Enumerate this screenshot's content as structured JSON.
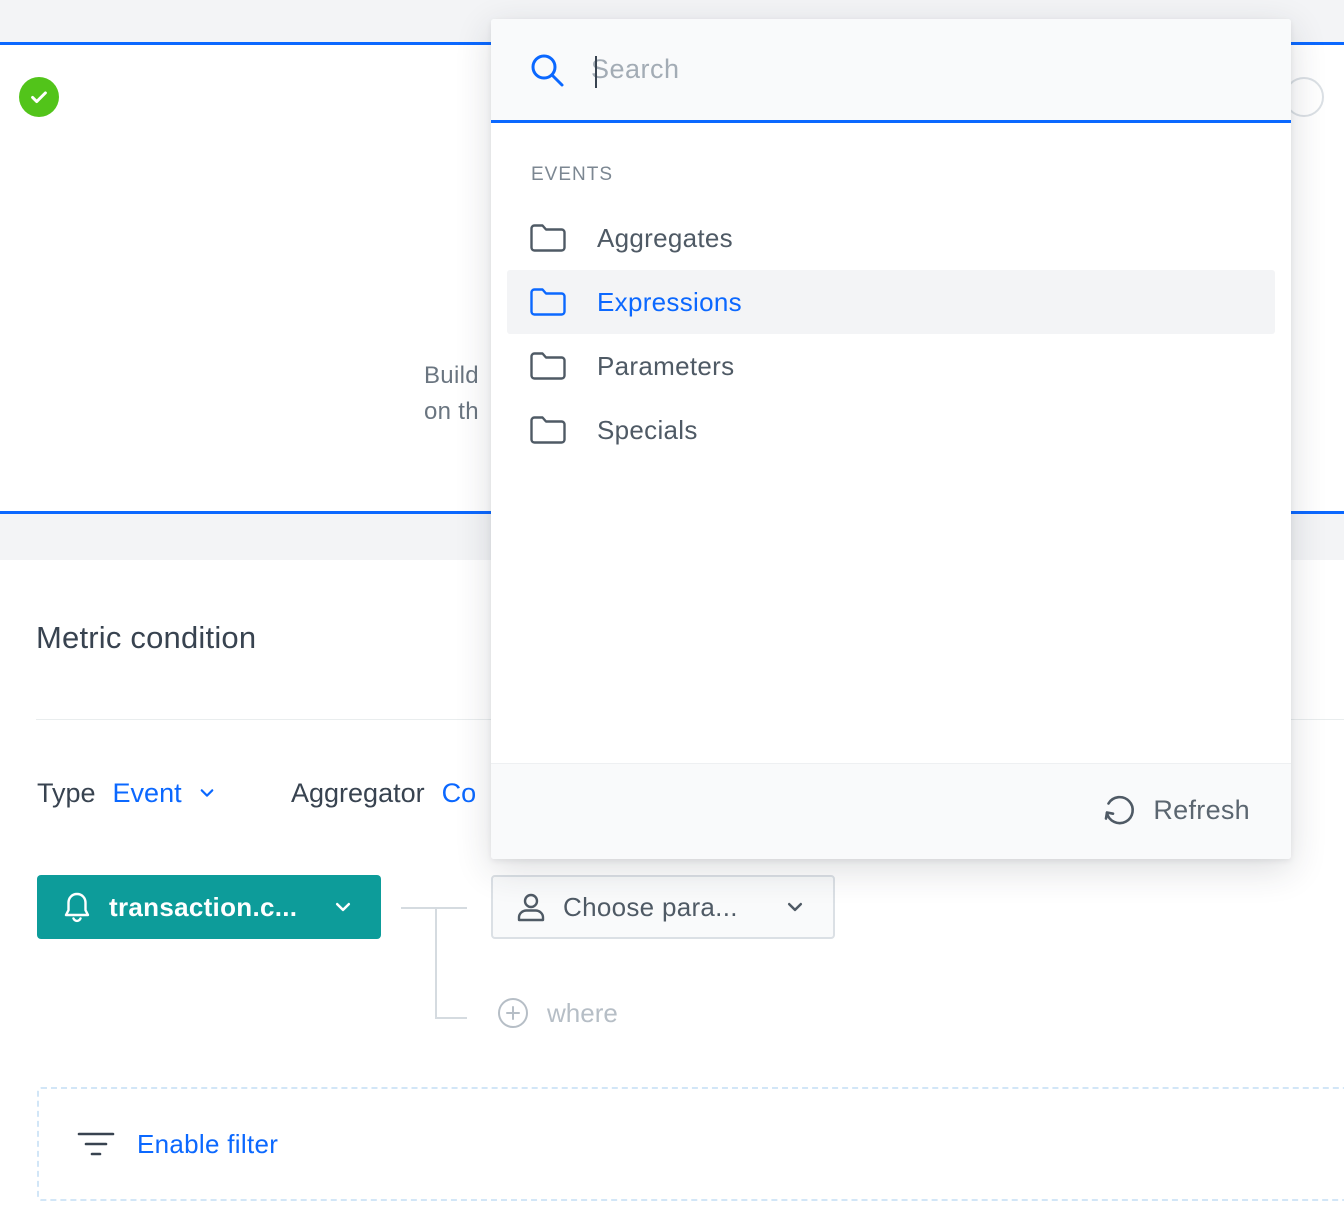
{
  "wizard": {
    "step_done_icon": "check-circle-icon",
    "description_line1": "Build",
    "description_line2": "on th"
  },
  "section": {
    "title": "Metric condition"
  },
  "type_row": {
    "type_label": "Type",
    "type_value": "Event",
    "aggregator_label": "Aggregator",
    "aggregator_value": "Co"
  },
  "event_selector": {
    "icon": "bell-icon",
    "label": "transaction.c..."
  },
  "parameter_selector": {
    "icon": "user-icon",
    "label": "Choose para..."
  },
  "where": {
    "icon": "plus-circle-icon",
    "label": "where"
  },
  "filter": {
    "icon": "filter-icon",
    "label": "Enable filter"
  },
  "dropdown": {
    "search": {
      "placeholder": "Search",
      "value": ""
    },
    "group_label": "EVENTS",
    "items": [
      {
        "label": "Aggregates",
        "icon": "folder-icon",
        "active": false
      },
      {
        "label": "Expressions",
        "icon": "folder-icon",
        "active": true
      },
      {
        "label": "Parameters",
        "icon": "folder-icon",
        "active": false
      },
      {
        "label": "Specials",
        "icon": "folder-icon",
        "active": false
      }
    ],
    "refresh_label": "Refresh"
  },
  "colors": {
    "primary": "#0b68ff",
    "success": "#52c41a",
    "teal": "#0d9c9a",
    "text": "#384350"
  }
}
